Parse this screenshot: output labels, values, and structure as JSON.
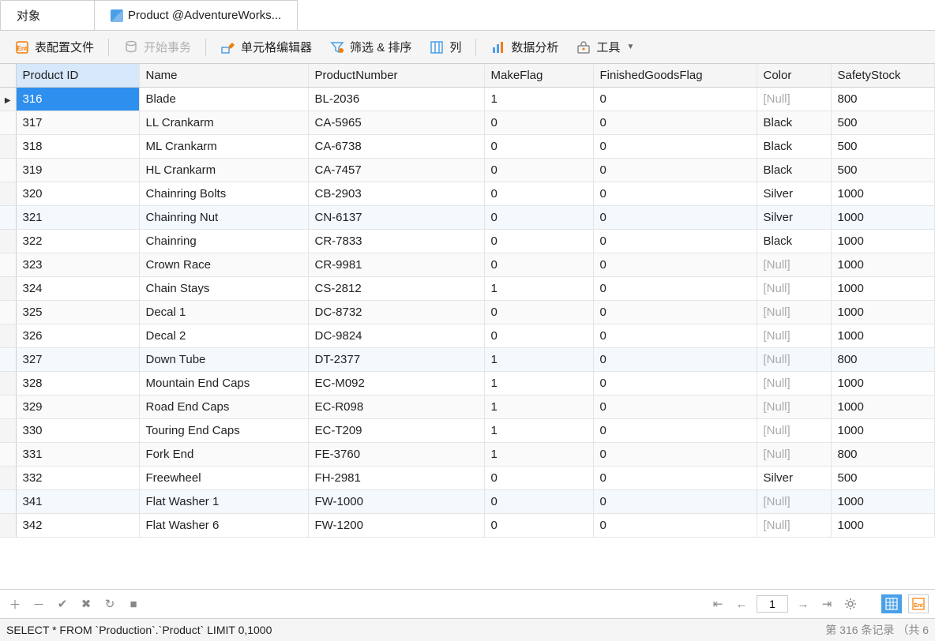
{
  "tabs": {
    "objects": "对象",
    "table": "Product @AdventureWorks..."
  },
  "toolbar": {
    "config": "表配置文件",
    "begin_tx": "开始事务",
    "cell_editor": "单元格编辑器",
    "filter_sort": "筛选 & 排序",
    "columns": "列",
    "analysis": "数据分析",
    "tools": "工具"
  },
  "columns": [
    "Product ID",
    "Name",
    "ProductNumber",
    "MakeFlag",
    "FinishedGoodsFlag",
    "Color",
    "SafetyStock"
  ],
  "rows": [
    {
      "id": "316",
      "name": "Blade",
      "pn": "BL-2036",
      "make": "1",
      "fin": "0",
      "color": null,
      "ss": "800",
      "sel": true,
      "blue": false
    },
    {
      "id": "317",
      "name": "LL Crankarm",
      "pn": "CA-5965",
      "make": "0",
      "fin": "0",
      "color": "Black",
      "ss": "500",
      "blue": false
    },
    {
      "id": "318",
      "name": "ML Crankarm",
      "pn": "CA-6738",
      "make": "0",
      "fin": "0",
      "color": "Black",
      "ss": "500",
      "blue": false
    },
    {
      "id": "319",
      "name": "HL Crankarm",
      "pn": "CA-7457",
      "make": "0",
      "fin": "0",
      "color": "Black",
      "ss": "500",
      "blue": false
    },
    {
      "id": "320",
      "name": "Chainring Bolts",
      "pn": "CB-2903",
      "make": "0",
      "fin": "0",
      "color": "Silver",
      "ss": "1000",
      "blue": false
    },
    {
      "id": "321",
      "name": "Chainring Nut",
      "pn": "CN-6137",
      "make": "0",
      "fin": "0",
      "color": "Silver",
      "ss": "1000",
      "blue": true
    },
    {
      "id": "322",
      "name": "Chainring",
      "pn": "CR-7833",
      "make": "0",
      "fin": "0",
      "color": "Black",
      "ss": "1000",
      "blue": false
    },
    {
      "id": "323",
      "name": "Crown Race",
      "pn": "CR-9981",
      "make": "0",
      "fin": "0",
      "color": null,
      "ss": "1000",
      "blue": false
    },
    {
      "id": "324",
      "name": "Chain Stays",
      "pn": "CS-2812",
      "make": "1",
      "fin": "0",
      "color": null,
      "ss": "1000",
      "blue": false
    },
    {
      "id": "325",
      "name": "Decal 1",
      "pn": "DC-8732",
      "make": "0",
      "fin": "0",
      "color": null,
      "ss": "1000",
      "blue": false
    },
    {
      "id": "326",
      "name": "Decal 2",
      "pn": "DC-9824",
      "make": "0",
      "fin": "0",
      "color": null,
      "ss": "1000",
      "blue": false
    },
    {
      "id": "327",
      "name": "Down Tube",
      "pn": "DT-2377",
      "make": "1",
      "fin": "0",
      "color": null,
      "ss": "800",
      "blue": true
    },
    {
      "id": "328",
      "name": "Mountain End Caps",
      "pn": "EC-M092",
      "make": "1",
      "fin": "0",
      "color": null,
      "ss": "1000",
      "blue": false
    },
    {
      "id": "329",
      "name": "Road End Caps",
      "pn": "EC-R098",
      "make": "1",
      "fin": "0",
      "color": null,
      "ss": "1000",
      "blue": false
    },
    {
      "id": "330",
      "name": "Touring End Caps",
      "pn": "EC-T209",
      "make": "1",
      "fin": "0",
      "color": null,
      "ss": "1000",
      "blue": false
    },
    {
      "id": "331",
      "name": "Fork End",
      "pn": "FE-3760",
      "make": "1",
      "fin": "0",
      "color": null,
      "ss": "800",
      "blue": false
    },
    {
      "id": "332",
      "name": "Freewheel",
      "pn": "FH-2981",
      "make": "0",
      "fin": "0",
      "color": "Silver",
      "ss": "500",
      "blue": false
    },
    {
      "id": "341",
      "name": "Flat Washer 1",
      "pn": "FW-1000",
      "make": "0",
      "fin": "0",
      "color": null,
      "ss": "1000",
      "blue": true
    },
    {
      "id": "342",
      "name": "Flat Washer 6",
      "pn": "FW-1200",
      "make": "0",
      "fin": "0",
      "color": null,
      "ss": "1000",
      "blue": false
    }
  ],
  "null_label": "[Null]",
  "nav": {
    "page": "1"
  },
  "status": {
    "sql": "SELECT * FROM `Production`.`Product` LIMIT 0,1000",
    "record": "第 316 条记录 （共 6"
  }
}
